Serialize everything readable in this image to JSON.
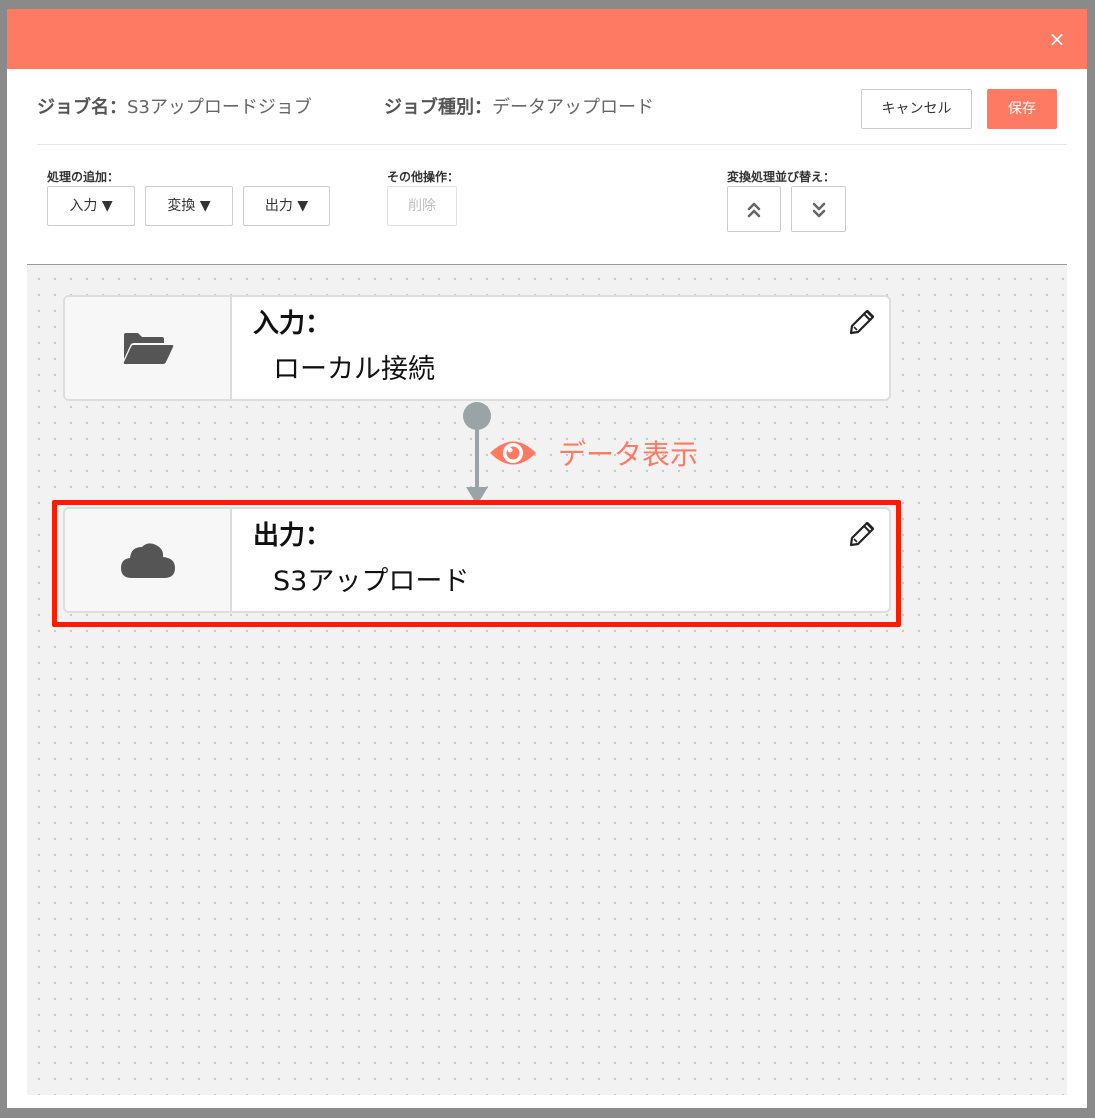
{
  "header": {
    "close_glyph": "×"
  },
  "job": {
    "name_label": "ジョブ名：",
    "name_value": "S3アップロードジョブ",
    "type_label": "ジョブ種別：",
    "type_value": "データアップロード"
  },
  "actions": {
    "cancel_label": "キャンセル",
    "save_label": "保存"
  },
  "toolbar": {
    "add_label": "処理の追加：",
    "add_buttons": [
      "入力 ▼",
      "変換 ▼",
      "出力 ▼"
    ],
    "other_label": "その他操作：",
    "delete_label": "削除",
    "reorder_label": "変換処理並び替え："
  },
  "flow": {
    "nodes": [
      {
        "title": "入力：",
        "value": "ローカル接続",
        "icon": "folder-open-icon"
      },
      {
        "title": "出力：",
        "value": "S3アップロード",
        "icon": "cloud-icon"
      }
    ],
    "data_view_label": "データ表示"
  },
  "colors": {
    "accent": "#ff7a62",
    "highlight": "#ff1a00",
    "connector": "#9aa3a6"
  }
}
